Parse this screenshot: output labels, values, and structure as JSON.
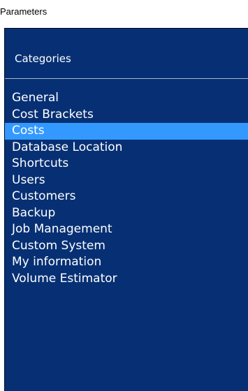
{
  "window": {
    "title": "Parameters"
  },
  "panel": {
    "header_label": "Categories"
  },
  "categories": {
    "selected_index": 2,
    "items": [
      {
        "label": "General"
      },
      {
        "label": "Cost Brackets"
      },
      {
        "label": "Costs"
      },
      {
        "label": "Database Location"
      },
      {
        "label": "Shortcuts"
      },
      {
        "label": "Users"
      },
      {
        "label": "Customers"
      },
      {
        "label": "Backup"
      },
      {
        "label": "Job Management"
      },
      {
        "label": "Custom System"
      },
      {
        "label": "My information"
      },
      {
        "label": "Volume Estimator"
      }
    ]
  },
  "colors": {
    "panel_background": "#073074",
    "selection_background": "#3399ff",
    "text": "#ffffff"
  }
}
